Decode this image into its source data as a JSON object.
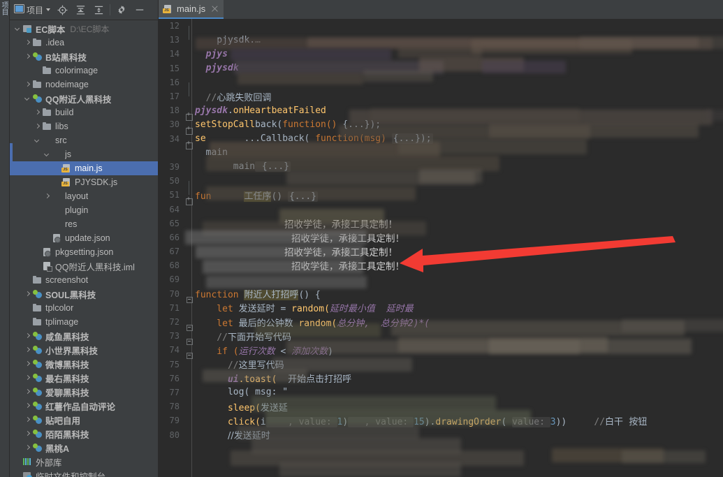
{
  "window": {
    "toolstrip_label": "项目"
  },
  "panel_toolbar": {
    "project_label": "项目",
    "icons": [
      {
        "name": "project-view-icon",
        "glyph": "▣"
      },
      {
        "name": "locate-target-icon",
        "glyph": "⊕"
      },
      {
        "name": "expand-all-icon",
        "glyph": "⇕"
      },
      {
        "name": "collapse-all-icon",
        "glyph": "⇳"
      },
      {
        "name": "settings-gear-icon",
        "glyph": "⚙"
      },
      {
        "name": "hide-panel-icon",
        "glyph": "—"
      }
    ]
  },
  "tree": [
    {
      "indent": 0,
      "arrow": "down",
      "icon": "proj",
      "label": "EC脚本",
      "bold": true,
      "sub": "D:\\EC脚本",
      "selected": false
    },
    {
      "indent": 1,
      "arrow": "right",
      "icon": "folder",
      "label": ".idea",
      "bold": false,
      "sub": "",
      "selected": false
    },
    {
      "indent": 1,
      "arrow": "right",
      "icon": "module",
      "label": "B站黑科技",
      "bold": true,
      "sub": "",
      "selected": false
    },
    {
      "indent": 2,
      "arrow": "none",
      "icon": "folder",
      "label": "colorimage",
      "bold": false,
      "sub": "",
      "selected": false
    },
    {
      "indent": 1,
      "arrow": "right",
      "icon": "folder",
      "label": "nodeimage",
      "bold": false,
      "sub": "",
      "selected": false
    },
    {
      "indent": 1,
      "arrow": "down",
      "icon": "module",
      "label": "QQ附近人黑科技",
      "bold": true,
      "sub": "",
      "selected": false
    },
    {
      "indent": 2,
      "arrow": "right",
      "icon": "folder",
      "label": "build",
      "bold": false,
      "sub": "",
      "selected": false
    },
    {
      "indent": 2,
      "arrow": "right",
      "icon": "folder",
      "label": "libs",
      "bold": false,
      "sub": "",
      "selected": false
    },
    {
      "indent": 2,
      "arrow": "down",
      "icon": "folder-src",
      "label": "src",
      "bold": false,
      "sub": "",
      "selected": false
    },
    {
      "indent": 3,
      "arrow": "down",
      "icon": "folder-src",
      "label": "js",
      "bold": false,
      "sub": "",
      "selected": false
    },
    {
      "indent": 4,
      "arrow": "none",
      "icon": "js",
      "label": "main.js",
      "bold": false,
      "sub": "",
      "selected": true
    },
    {
      "indent": 4,
      "arrow": "none",
      "icon": "js",
      "label": "PJYSDK.js",
      "bold": false,
      "sub": "",
      "selected": false
    },
    {
      "indent": 3,
      "arrow": "right",
      "icon": "folder-src",
      "label": "layout",
      "bold": false,
      "sub": "",
      "selected": false
    },
    {
      "indent": 3,
      "arrow": "none",
      "icon": "folder-src",
      "label": "plugin",
      "bold": false,
      "sub": "",
      "selected": false
    },
    {
      "indent": 3,
      "arrow": "none",
      "icon": "folder-src",
      "label": "res",
      "bold": false,
      "sub": "",
      "selected": false
    },
    {
      "indent": 3,
      "arrow": "none",
      "icon": "json",
      "label": "update.json",
      "bold": false,
      "sub": "",
      "selected": false
    },
    {
      "indent": 2,
      "arrow": "none",
      "icon": "json",
      "label": "pkgsetting.json",
      "bold": false,
      "sub": "",
      "selected": false
    },
    {
      "indent": 2,
      "arrow": "none",
      "icon": "iml",
      "label": "QQ附近人黑科技.iml",
      "bold": false,
      "sub": "",
      "selected": false
    },
    {
      "indent": 1,
      "arrow": "none",
      "icon": "folder",
      "label": "screenshot",
      "bold": false,
      "sub": "",
      "selected": false
    },
    {
      "indent": 1,
      "arrow": "right",
      "icon": "module",
      "label": "SOUL黑科技",
      "bold": true,
      "sub": "",
      "selected": false
    },
    {
      "indent": 1,
      "arrow": "none",
      "icon": "folder",
      "label": "tplcolor",
      "bold": false,
      "sub": "",
      "selected": false
    },
    {
      "indent": 1,
      "arrow": "none",
      "icon": "folder",
      "label": "tplimage",
      "bold": false,
      "sub": "",
      "selected": false
    },
    {
      "indent": 1,
      "arrow": "right",
      "icon": "module",
      "label": "咸鱼黑科技",
      "bold": true,
      "sub": "",
      "selected": false
    },
    {
      "indent": 1,
      "arrow": "right",
      "icon": "module",
      "label": "小世界黑科技",
      "bold": true,
      "sub": "",
      "selected": false
    },
    {
      "indent": 1,
      "arrow": "right",
      "icon": "module",
      "label": "微博黑科技",
      "bold": true,
      "sub": "",
      "selected": false
    },
    {
      "indent": 1,
      "arrow": "right",
      "icon": "module",
      "label": "最右黑科技",
      "bold": true,
      "sub": "",
      "selected": false
    },
    {
      "indent": 1,
      "arrow": "right",
      "icon": "module",
      "label": "爱聊黑科技",
      "bold": true,
      "sub": "",
      "selected": false
    },
    {
      "indent": 1,
      "arrow": "right",
      "icon": "module",
      "label": "红薯作品自动评论",
      "bold": true,
      "sub": "",
      "selected": false
    },
    {
      "indent": 1,
      "arrow": "right",
      "icon": "module",
      "label": "贴吧自用",
      "bold": true,
      "sub": "",
      "selected": false
    },
    {
      "indent": 1,
      "arrow": "right",
      "icon": "module",
      "label": "陌陌黑科技",
      "bold": true,
      "sub": "",
      "selected": false
    },
    {
      "indent": 1,
      "arrow": "right",
      "icon": "module",
      "label": "黑桃A",
      "bold": true,
      "sub": "",
      "selected": false
    },
    {
      "indent": 0,
      "arrow": "none",
      "icon": "lib",
      "label": "外部库",
      "bold": false,
      "sub": "",
      "selected": false
    },
    {
      "indent": 0,
      "arrow": "none",
      "icon": "scratch",
      "label": "临时文件和控制台",
      "bold": false,
      "sub": "",
      "selected": false
    }
  ],
  "editor": {
    "tab": {
      "label": "main.js",
      "icon": "js-file-icon",
      "close": "×"
    },
    "lines": [
      {
        "num": "12",
        "fold": "bar",
        "segs": []
      },
      {
        "num": "13",
        "fold": "none",
        "segs": [
          {
            "t": "    pjysdk.",
            "c": "ident"
          },
          {
            "t": "…",
            "c": "cmt"
          }
        ]
      },
      {
        "num": "14",
        "fold": "none",
        "segs": [
          {
            "t": "  ",
            "c": "ident"
          },
          {
            "t": "pjys",
            "c": "field"
          }
        ]
      },
      {
        "num": "15",
        "fold": "none",
        "segs": [
          {
            "t": "  ",
            "c": "ident"
          },
          {
            "t": "pjysdk",
            "c": "field"
          }
        ]
      },
      {
        "num": "16",
        "fold": "bar",
        "segs": []
      },
      {
        "num": "17",
        "fold": "none",
        "segs": [
          {
            "t": "  //",
            "c": "cmt"
          },
          {
            "t": "心跳失败回调",
            "c": "cmtcn"
          }
        ]
      },
      {
        "num": "18",
        "fold": "plus",
        "segs": [
          {
            "t": "pjysdk",
            "c": "field"
          },
          {
            "t": ".",
            "c": "ident"
          },
          {
            "t": "onHeartbeatFailed",
            "c": "fn"
          }
        ]
      },
      {
        "num": "30",
        "fold": "plus",
        "segs": [
          {
            "t": "setStopCall",
            "c": "fn"
          },
          {
            "t": "back(",
            "c": "ident"
          },
          {
            "t": "function()",
            "c": "kw"
          },
          {
            "t": " {...});",
            "c": "ident"
          }
        ]
      },
      {
        "num": "34",
        "fold": "plus",
        "segs": [
          {
            "t": "se",
            "c": "fn"
          },
          {
            "t": "       ",
            "c": "ident"
          },
          {
            "t": "...Callback( ",
            "c": "ident"
          },
          {
            "t": "function(msg) ",
            "c": "kw"
          },
          {
            "t": "{...});",
            "c": "fold"
          }
        ]
      },
      {
        "num": "",
        "fold": "none",
        "segs": [
          {
            "t": "  main",
            "c": "ident"
          }
        ]
      },
      {
        "num": "39",
        "fold": "none",
        "segs": [
          {
            "t": "       main",
            "c": "ident"
          },
          {
            "t": " {...}",
            "c": "fold"
          }
        ]
      },
      {
        "num": "50",
        "fold": "bar",
        "segs": []
      },
      {
        "num": "51",
        "fold": "plus",
        "segs": [
          {
            "t": "fun",
            "c": "kw"
          },
          {
            "t": "      ",
            "c": "ident"
          },
          {
            "t": "工任序",
            "c": "fnhl"
          },
          {
            "t": "() ",
            "c": "ident"
          },
          {
            "t": "{...}",
            "c": "fold"
          }
        ]
      },
      {
        "num": "64",
        "fold": "none",
        "segs": []
      },
      {
        "num": "65",
        "fold": "none",
        "segs": [
          {
            "t": "招收学徒，承接工具定制！",
            "c": "adtext"
          }
        ]
      },
      {
        "num": "66",
        "fold": "none",
        "segs": [
          {
            "t": "招收学徒，承接工具定制！",
            "c": "adtext"
          }
        ]
      },
      {
        "num": "67",
        "fold": "none",
        "segs": [
          {
            "t": "招收学徒，承接工具定制！",
            "c": "adtext"
          }
        ]
      },
      {
        "num": "68",
        "fold": "none",
        "segs": [
          {
            "t": "招收学徒，承接工具定制！",
            "c": "adtext"
          }
        ]
      },
      {
        "num": "69",
        "fold": "none",
        "segs": []
      },
      {
        "num": "70",
        "fold": "minus",
        "segs": [
          {
            "t": "function ",
            "c": "kw"
          },
          {
            "t": "附近人打招呼",
            "c": "fnhl"
          },
          {
            "t": "() {",
            "c": "ident"
          }
        ]
      },
      {
        "num": "71",
        "fold": "none",
        "segs": [
          {
            "t": "    let ",
            "c": "kw"
          },
          {
            "t": "发送延时",
            "c": "identcn"
          },
          {
            "t": " = ",
            "c": "ident"
          },
          {
            "t": "random(",
            "c": "fn"
          },
          {
            "t": "延时最小值",
            "c": "param"
          },
          {
            "t": "  延时最",
            "c": "param"
          }
        ]
      },
      {
        "num": "72",
        "fold": "minus",
        "segs": [
          {
            "t": "    let ",
            "c": "kw"
          },
          {
            "t": "最后的公钟数",
            "c": "identcn"
          },
          {
            "t": " random(",
            "c": "fn"
          },
          {
            "t": "总分钟,  总分钟2)*(",
            "c": "param"
          }
        ]
      },
      {
        "num": "73",
        "fold": "minus",
        "segs": [
          {
            "t": "    //",
            "c": "cmt"
          },
          {
            "t": "下面开始写代码",
            "c": "cmtcn"
          }
        ]
      },
      {
        "num": "74",
        "fold": "minus",
        "segs": [
          {
            "t": "    if (",
            "c": "kw"
          },
          {
            "t": "运行次数",
            "c": "param"
          },
          {
            "t": " < ",
            "c": "ident"
          },
          {
            "t": "添加次数",
            "c": "param"
          },
          {
            "t": ")",
            "c": "ident"
          }
        ]
      },
      {
        "num": "75",
        "fold": "none",
        "segs": [
          {
            "t": "      //",
            "c": "cmt"
          },
          {
            "t": "这里写代码",
            "c": "cmtcn"
          }
        ]
      },
      {
        "num": "76",
        "fold": "none",
        "segs": [
          {
            "t": "      ui",
            "c": "field"
          },
          {
            "t": ".toast(",
            "c": "fn"
          },
          {
            "t": "  ",
            "c": "ident"
          },
          {
            "t": "开始点击打招呼",
            "c": "cmtcn"
          }
        ]
      },
      {
        "num": "77",
        "fold": "none",
        "segs": [
          {
            "t": "      log( msg: \"",
            "c": "ident"
          }
        ]
      },
      {
        "num": "78",
        "fold": "none",
        "segs": [
          {
            "t": "      sleep(",
            "c": "fn"
          },
          {
            "t": "发送延",
            "c": "identcn"
          }
        ]
      },
      {
        "num": "79",
        "fold": "none",
        "segs": [
          {
            "t": "      click(",
            "c": "fn"
          },
          {
            "t": "i",
            "c": "ident"
          },
          {
            "t": "    , value: ",
            "c": "hintc"
          },
          {
            "t": "1",
            "c": "num"
          },
          {
            "t": ")",
            "c": "ident"
          },
          {
            "t": "   , value: ",
            "c": "hintc"
          },
          {
            "t": "15",
            "c": "num"
          },
          {
            "t": ").",
            "c": "ident"
          },
          {
            "t": "drawingOrder",
            "c": "fn"
          },
          {
            "t": "( ",
            "c": "ident"
          },
          {
            "t": "value: ",
            "c": "hintc"
          },
          {
            "t": "3",
            "c": "num"
          },
          {
            "t": "))",
            "c": "ident"
          },
          {
            "t": "     //",
            "c": "cmt"
          },
          {
            "t": "白干",
            "c": "cmtcn"
          },
          {
            "t": "  按钮",
            "c": "cmtcn"
          }
        ]
      },
      {
        "num": "80",
        "fold": "none",
        "segs": [
          {
            "t": "      ",
            "c": "ident"
          },
          {
            "t": "//发送延时",
            "c": "cmtcn"
          }
        ]
      }
    ],
    "ad_text": "招收学徒，承接工具定制！"
  },
  "annotation": {
    "arrow_color": "#f23b33",
    "name": "red-pointer-arrow"
  },
  "colors": {
    "selection_blue": "#4b6eaf",
    "tab_underline": "#4a88c7",
    "editor_bg": "#2b2b2b",
    "panel_bg": "#3c3f41",
    "keyword_orange": "#cc7832",
    "function_yellow": "#ffc66d",
    "field_purple": "#9876aa",
    "number_blue": "#6897bb"
  }
}
